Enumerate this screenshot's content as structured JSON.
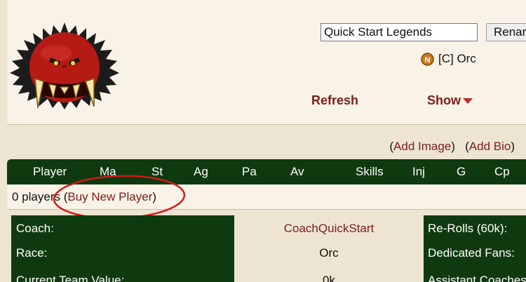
{
  "team": {
    "name_value": "Quick Start Legends",
    "rename_label": "Renar",
    "race_label": "[C] Orc",
    "refresh_label": "Refresh",
    "show_label": "Show"
  },
  "links": {
    "add_image": "Add Image",
    "add_bio": "Add Bio"
  },
  "roster": {
    "columns": [
      "Player",
      "Ma",
      "St",
      "Ag",
      "Pa",
      "Av",
      "Skills",
      "Inj",
      "G",
      "Cp"
    ],
    "players_count_text": "0 players",
    "buy_new_player": "Buy New Player"
  },
  "info": {
    "coach_label": "Coach:",
    "race_label": "Race:",
    "tv_label": "Current Team Value:",
    "coach_value": "CoachQuickStart",
    "race_value": "Orc",
    "tv_value": "0k",
    "rerolls_label": "Re-Rolls (60k):",
    "fans_label": "Dedicated Fans:",
    "assistant_label": "Assistant Coaches:"
  },
  "colors": {
    "header_green": "#0f3a0f",
    "link_red": "#7c1c1c",
    "panel_bg": "#f8f3e6",
    "page_bg": "#ede5d2",
    "annotation": "#d31a1a"
  },
  "icons": {
    "logo": "orc-team-logo",
    "race_coin": "orc-race-coin-icon",
    "show_arrow": "caret-down-icon"
  }
}
